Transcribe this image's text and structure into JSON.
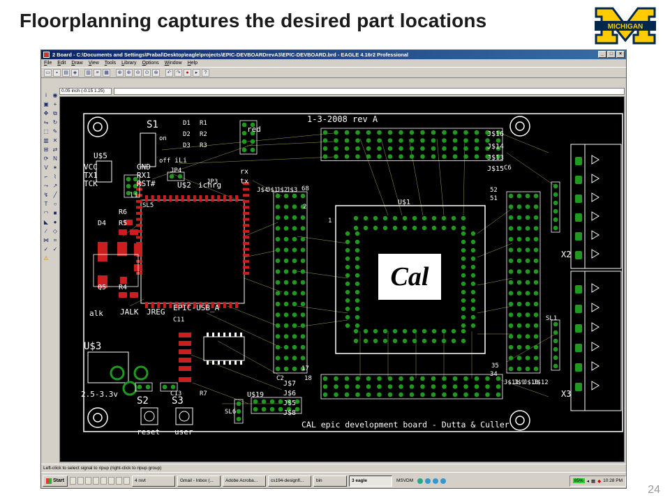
{
  "slide": {
    "title": "Floorplanning captures the desired part locations",
    "page_number": "24",
    "logo_text": "MICHIGAN"
  },
  "window": {
    "title": "2 Board - C:\\Documents and Settings\\Prabal\\Desktop\\eagle\\projects\\EPIC-DEVBOARDrevA3\\EPIC-DEVBOARD.brd - EAGLE 4.16r2 Professional",
    "controls": [
      "_",
      "□",
      "×"
    ]
  },
  "menu": [
    "File",
    "Edit",
    "Draw",
    "View",
    "Tools",
    "Library",
    "Options",
    "Window",
    "Help"
  ],
  "coord_readout": "0.05 inch (-0.15 1.25)",
  "status_text": "Left-click to select signal to ripup (right-click to ripup group)",
  "board": {
    "title_text": "1-3-2008 rev A",
    "footer_text": "CAL epic development board - Dutta & Culler",
    "logo_text": "Cal",
    "labels": {
      "s1": "S1",
      "on": "on",
      "off": "off",
      "u5": "U$5",
      "vcc": "VCC",
      "tx1": "TX1",
      "tck": "TCK",
      "gnd": "GND",
      "rx1": "RX1",
      "rst": "RST#",
      "li1": "li",
      "d1": "D1",
      "r1": "R1",
      "d2": "D2",
      "r2": "R2",
      "d3": "D3",
      "r3": "R3",
      "red": "red",
      "li2": "iLi",
      "jp4": "JP4",
      "jp3": "JP3",
      "u2": "U$2",
      "ichrg": "ichrg",
      "rx": "rx",
      "tx": "tx",
      "j4": "J$4",
      "j1": "J$1",
      "j2": "J$2",
      "j3": "J$3",
      "j16": "J$16",
      "j14": "J$14",
      "j13": "J$13",
      "j15": "J$15",
      "c6": "C6",
      "u1": "U$1",
      "sl5": "SL5",
      "r6": "R6",
      "d4": "D4",
      "r5": "R5",
      "r4": "R4",
      "q5": "Q5",
      "alk": "alk",
      "jalk": "JALK",
      "jreg": "JREG",
      "epic_usb": "EPIC-USB_A",
      "c11": "C11",
      "u3": "U$3",
      "vreg": "2.5-3.3v",
      "s2": "S2",
      "s3": "S3",
      "reset": "reset",
      "user": "user",
      "c13": "C13",
      "r7": "R7",
      "sl6": "SL6",
      "u19": "U$19",
      "c2": "C2",
      "j7": "J$7",
      "j6": "J$6",
      "j5": "J$5",
      "j8": "J$8",
      "j11": "J$11",
      "j9": "J$9",
      "j10": "J$10",
      "j12": "J$12",
      "sl1": "SL1",
      "x2": "X2",
      "x3": "X3",
      "p1": "1",
      "p2": "2",
      "p17": "17",
      "p18": "18",
      "p34": "34",
      "p35": "35",
      "p51": "51",
      "p52": "52",
      "p68": "68"
    }
  },
  "taskbar": {
    "start": "Start",
    "tasks": [
      "4 rxvt",
      "Gmail - Inbox (...",
      "Adobe Acroba...",
      "cs194-designfl...",
      "bin",
      "3 eagle"
    ],
    "active_task": "3 eagle",
    "tray_misc": "MSVDM",
    "battery": "85%",
    "clock": "10:28 PM"
  },
  "colors": {
    "board_bg": "#000000",
    "silkscreen": "#ffffff",
    "pads": "#1f9a1f",
    "airwires": "#c8c864",
    "smd_red": "#cc1e1e",
    "title_text": "#1a1a1a",
    "michigan_blue": "#00274c",
    "michigan_maize": "#ffcb05"
  }
}
